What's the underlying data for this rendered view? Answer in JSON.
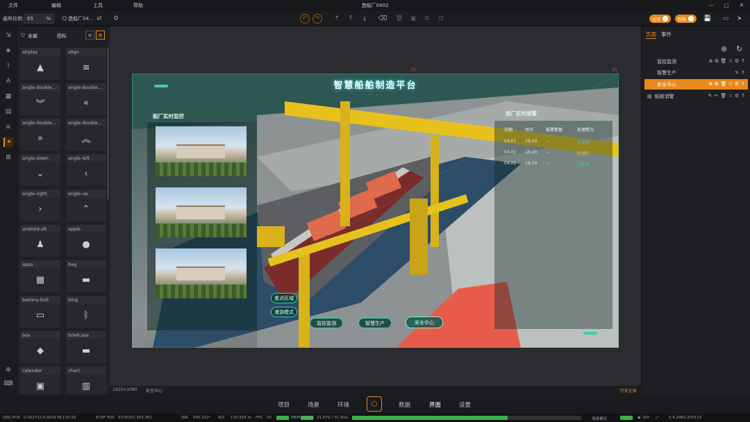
{
  "menu": {
    "items": [
      "文件",
      "编辑",
      "工具",
      "帮助"
    ],
    "window_title": "造船厂0402"
  },
  "toolbar": {
    "canvas_ratio_label": "画布比例",
    "canvas_ratio_value": "65",
    "canvas_ratio_unit": "%",
    "project_name": "造船厂04...",
    "toggle_a": "运动",
    "toggle_b": "网格"
  },
  "components": {
    "filter_label": "全部",
    "icon_label": "图标",
    "items": [
      {
        "label": "airplay",
        "icon": "airplay-icon",
        "glyph": "▲"
      },
      {
        "label": "align",
        "icon": "align-icon",
        "glyph": "≡"
      },
      {
        "label": "angle-double...",
        "icon": "angle-double-down-icon",
        "glyph": "︾"
      },
      {
        "label": "angle-double...",
        "icon": "angle-double-left-icon",
        "glyph": "«"
      },
      {
        "label": "angle-double...",
        "icon": "angle-double-right-icon",
        "glyph": "»"
      },
      {
        "label": "angle-double...",
        "icon": "angle-double-up-icon",
        "glyph": "︽"
      },
      {
        "label": "angle-down",
        "icon": "angle-down-icon",
        "glyph": "⌄"
      },
      {
        "label": "angle-left",
        "icon": "angle-left-icon",
        "glyph": "‹"
      },
      {
        "label": "angle-right",
        "icon": "angle-right-icon",
        "glyph": "›"
      },
      {
        "label": "angle-up",
        "icon": "angle-up-icon",
        "glyph": "⌃"
      },
      {
        "label": "android-alt",
        "icon": "android-icon",
        "glyph": "♟"
      },
      {
        "label": "apple",
        "icon": "apple-icon",
        "glyph": "●"
      },
      {
        "label": "apps",
        "icon": "apps-icon",
        "glyph": "▦"
      },
      {
        "label": "bag",
        "icon": "bag-icon",
        "glyph": "▬"
      },
      {
        "label": "battery-bolt",
        "icon": "battery-bolt-icon",
        "glyph": "▭"
      },
      {
        "label": "bing",
        "icon": "bing-icon",
        "glyph": "ᛒ"
      },
      {
        "label": "box",
        "icon": "box-icon",
        "glyph": "◆"
      },
      {
        "label": "briefcase",
        "icon": "briefcase-icon",
        "glyph": "▬"
      },
      {
        "label": "calender",
        "icon": "calendar-icon",
        "glyph": "▣"
      },
      {
        "label": "chart",
        "icon": "chart-icon",
        "glyph": "▥"
      }
    ]
  },
  "scene": {
    "title": "智慧船舶制造平台",
    "left_panel_title": "船厂实时监控",
    "right_panel_title": "船厂实时报警",
    "table_headers": [
      "日期",
      "时间",
      "报警数据",
      "处理情况"
    ],
    "table_rows": [
      [
        "04.01",
        "18:20",
        "--",
        "未处理"
      ],
      [
        "04.01",
        "18:20",
        "--",
        "处理中"
      ],
      [
        "04.01",
        "18:20",
        "--",
        "已处理"
      ]
    ],
    "side_buttons": [
      "重点区域",
      "漫游模式"
    ],
    "nav_buttons": [
      "监控监测",
      "智慧生产",
      "安全中心"
    ]
  },
  "canvas_status": {
    "resolution": "1920×1080",
    "page": "安全中心",
    "right": "历史记录"
  },
  "right_panel": {
    "tabs": [
      "页面",
      "事件"
    ],
    "pages": [
      {
        "label": "监控监测",
        "selected": false
      },
      {
        "label": "智慧生产",
        "selected": false
      },
      {
        "label": "安全中心",
        "selected": true
      },
      {
        "label": "船舶消警",
        "selected": false
      }
    ]
  },
  "bottom_tabs": [
    "项目",
    "场景",
    "环境",
    "数据",
    "界面",
    "设置"
  ],
  "active_bottom_tab": "界面",
  "stats": {
    "geo_pos_label": "GEO POS",
    "geo_pos": "0.002722,0.003178,115.93",
    "ecef_label": "ECEF POS",
    "ecef": "6378252,303,351",
    "dir_label": "DIR",
    "dir": "095.222°",
    "alt_label": "ALT",
    "alt": "115.933 m",
    "fps_label": "FPS",
    "fps": "20",
    "mem_label": "MEM",
    "mem": "6.6G",
    "mem2": "21.57G / 31.91G",
    "mem_fraction": 0.68,
    "mode_label": "场景模式",
    "count": "0/0",
    "version": "5.4.2482.250113"
  },
  "colors": {
    "accent": "#e8891a",
    "hud": "#3ccfae"
  }
}
